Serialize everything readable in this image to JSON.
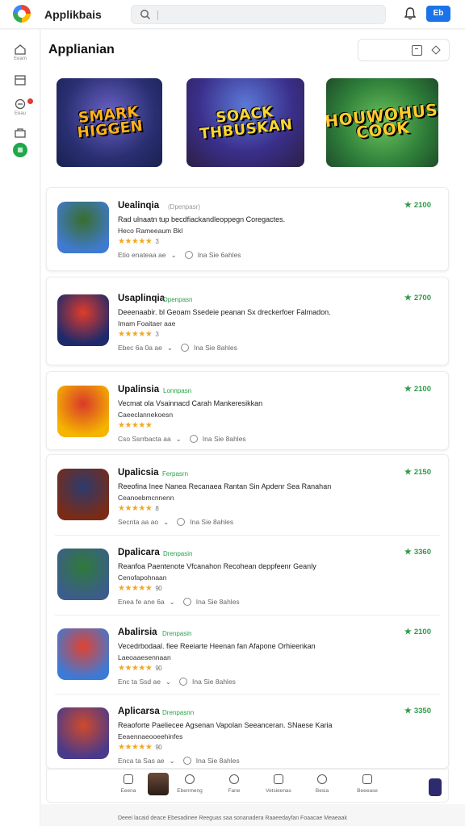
{
  "app": {
    "title": "Applikbais",
    "search_placeholder": "",
    "top_button": "Eb"
  },
  "rail": {
    "items": [
      {
        "label": "Eeam",
        "icon": "home-icon"
      },
      {
        "label": "",
        "icon": "inbox-icon"
      },
      {
        "label": "Eeau",
        "icon": "activity-icon"
      },
      {
        "label": "",
        "icon": "bag-icon"
      },
      {
        "label": "",
        "icon": "apps-icon"
      }
    ]
  },
  "page": {
    "title": "Applianian"
  },
  "banners": [
    {
      "text": "SMARK HIGGEN",
      "theme": "heroes"
    },
    {
      "text": "SOACK THBUSKAN",
      "theme": "robot-city"
    },
    {
      "text": "HOUWOHUS COOK",
      "theme": "jungle"
    }
  ],
  "apps": [
    {
      "name": "Uealinqia",
      "tag": "(Dpenpasr)",
      "tag_style": "gray",
      "score": "2100",
      "desc": "Rad ulnaatn tup becdfiackandleoppegn Coregactes.",
      "sub": "Heco Rameeaum   Bkl",
      "rating_count": "3",
      "meta_left": "Etio enateaa ae",
      "meta_right": "Ina Sie 6ahles",
      "colors": [
        "#3f7ad0",
        "#3a6d2c"
      ]
    },
    {
      "name": "Usaplinqia",
      "tag": "Dpenpasn",
      "tag_style": "green",
      "score": "2700",
      "desc": "Deeenaabir. bl Geoam Ssedeie peanan Sx dreckerfoer Falmadon.",
      "sub": "Imam Foaitaer aae",
      "rating_count": "3",
      "meta_left": "Ebec 6a 0a ae",
      "meta_right": "Ina Sie 8ahles",
      "colors": [
        "#1d2a6b",
        "#e03b2b"
      ]
    },
    {
      "name": "Upalinsia",
      "tag": "Lonnpasn",
      "tag_style": "green",
      "score": "2100",
      "desc": "Vecmat ola Vsainnacd Carah Mankeresikkan",
      "sub": "Caeeclannekoesn",
      "rating_count": "",
      "meta_left": "Cso Ssrrbacta aa",
      "meta_right": "Ina Sie 8ahles",
      "colors": [
        "#f5b400",
        "#d9392b"
      ]
    },
    {
      "name": "Upalicsia",
      "tag": "Ferpasrn",
      "tag_style": "green",
      "score": "2150",
      "desc": "Reeofina Inee Nanea Recanaea Rantan Sin Apdenr Sea Ranahan",
      "sub": "Ceanoebmcnnenn",
      "rating_count": "8",
      "meta_left": "Secnta aa ao",
      "meta_right": "Ina Sie 8ahles",
      "colors": [
        "#7a2b17",
        "#2b3b6f"
      ]
    },
    {
      "name": "Dpalicara",
      "tag": "Drenpasin",
      "tag_style": "green",
      "score": "3360",
      "desc": "Reanfoa Paentenote Vfcanahon Recohean deppfeenr Geanly",
      "sub": "Cenofapohnaan",
      "rating_count": "90",
      "meta_left": "Enea fe ane 6a",
      "meta_right": "Ina Sie 8ahles",
      "colors": [
        "#3b5d8a",
        "#2f7a3a"
      ]
    },
    {
      "name": "Abalirsia",
      "tag": "Drenpasin",
      "tag_style": "green",
      "score": "2100",
      "desc": "Vecedrbodaal. fiee Reeiarte Heenan fan Afapone Orhieenkan",
      "sub": "Laeoaaesennaan",
      "rating_count": "90",
      "meta_left": "Enc ta Ssd ae",
      "meta_right": "Ina Sie 8ahles",
      "colors": [
        "#3d7ad6",
        "#e24231"
      ]
    },
    {
      "name": "Aplicarsa",
      "tag": "Drenpasnn",
      "tag_style": "green",
      "score": "3350",
      "desc": "Reaoforte Paeliecee Agsenan Vapolan Seeanceran. SNaese Karia",
      "sub": "Eeaennaeooeehinfes",
      "rating_count": "90",
      "meta_left": "Enca ta Sas ae",
      "meta_right": "Ina Sie 8ahles",
      "colors": [
        "#4a3a8a",
        "#d04a2a"
      ]
    }
  ],
  "bottom_nav": [
    {
      "label": "Eeena",
      "icon": "library-icon"
    },
    {
      "label": "",
      "icon": "avatar-icon"
    },
    {
      "label": "Ebenmeng",
      "icon": "explore-icon"
    },
    {
      "label": "Fane",
      "icon": "smile-icon"
    },
    {
      "label": "Vetsieenas",
      "icon": "list-icon"
    },
    {
      "label": "Besia",
      "icon": "group-icon"
    },
    {
      "label": "Beeease",
      "icon": "image-icon"
    }
  ],
  "footer": "Deeei lacaid deace Ebesadinee Reeguas saa sonanadera Raaeedayfan Foaacae Meaeaak"
}
